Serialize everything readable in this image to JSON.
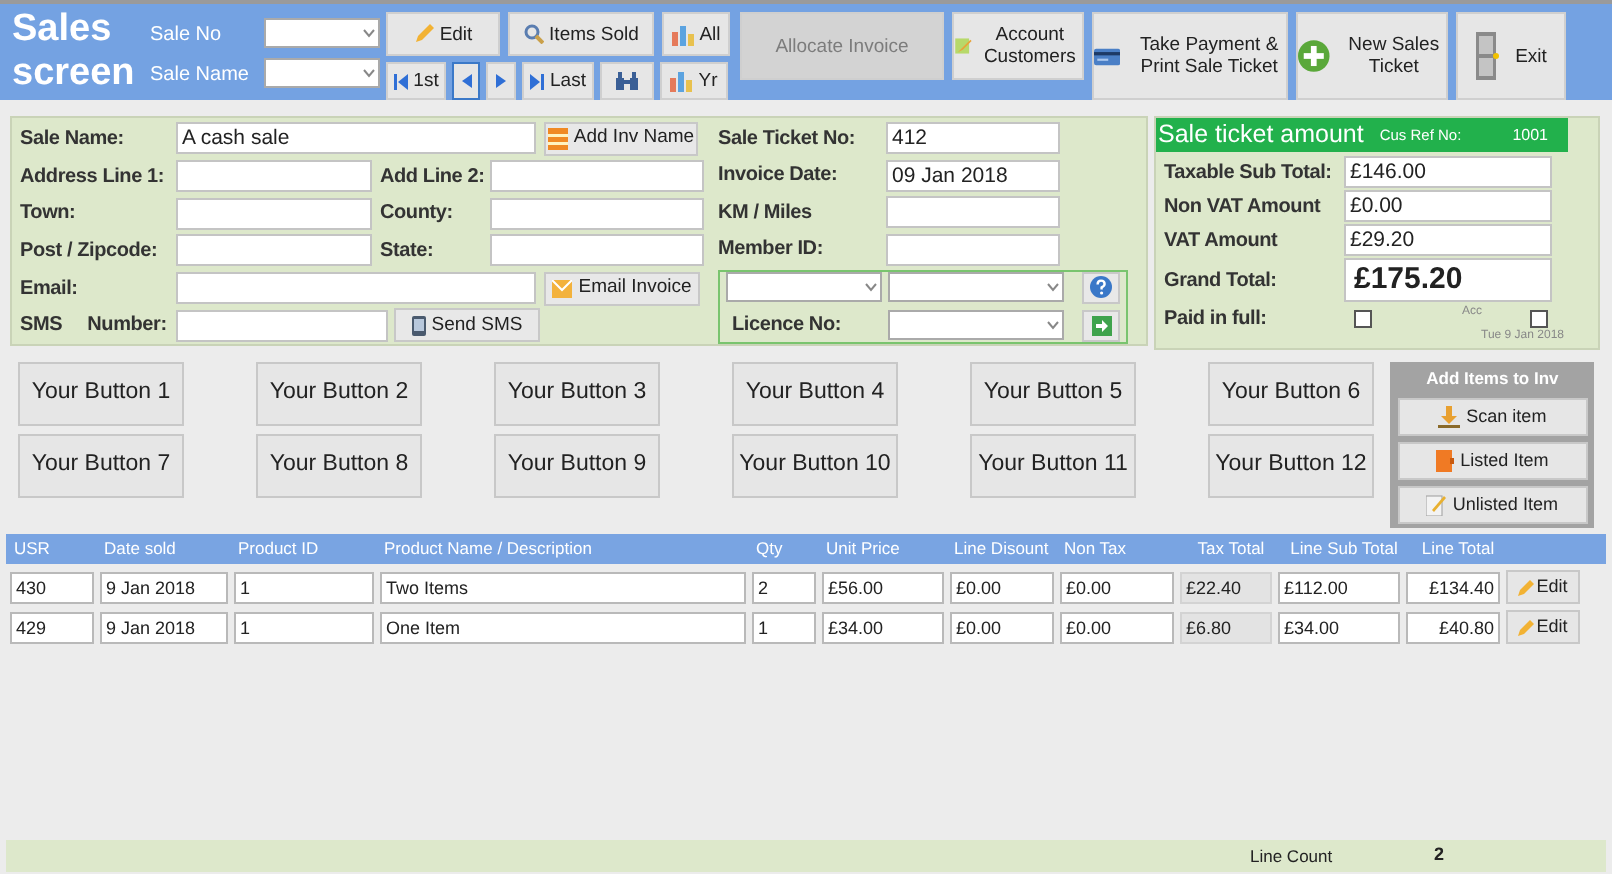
{
  "header": {
    "title": "Sales screen",
    "sale_no_label": "Sale No",
    "sale_name_label": "Sale Name",
    "buttons": [
      {
        "label": "Edit",
        "disabled": false
      },
      {
        "label": "Items Sold",
        "disabled": false
      },
      {
        "label": "All",
        "disabled": false
      },
      {
        "label": "Allocate Invoice",
        "disabled": true
      },
      {
        "label": "Account Customers",
        "disabled": false
      },
      {
        "label": "Take Payment & Print Sale Ticket",
        "disabled": false
      },
      {
        "label": "New Sales Ticket",
        "disabled": false
      },
      {
        "label": "Exit",
        "disabled": false
      },
      {
        "label": "1st",
        "disabled": false
      },
      {
        "label": "Last",
        "disabled": false
      },
      {
        "label": "Yr",
        "disabled": false
      }
    ]
  },
  "customer": {
    "sale_name_label": "Sale Name:",
    "sale_name": "A cash sale",
    "add_inv_name_button": "Add Inv Name",
    "address_fields": [
      {
        "label": "Address Line 1:"
      },
      {
        "label": "Add Line 2:"
      },
      {
        "label": "Town:"
      },
      {
        "label": "County:"
      },
      {
        "label": "Post / Zipcode:"
      },
      {
        "label": "State:"
      }
    ],
    "email_label": "Email:",
    "email_button": "Email Invoice",
    "sms_label": "SMS Number:",
    "send_sms_button": "Send SMS"
  },
  "ticket": {
    "fields": [
      {
        "label": "Sale Ticket No:",
        "value": "412"
      },
      {
        "label": "Invoice Date:",
        "value": "09 Jan 2018"
      },
      {
        "label": "KM / Miles"
      },
      {
        "label": "Member ID:"
      }
    ],
    "licence_label": "Licence No:"
  },
  "totals": {
    "title": "Sale ticket amount",
    "cus_ref_label": "Cus Ref No:",
    "cus_ref": "1001",
    "rows": [
      {
        "label": "Taxable Sub Total:",
        "value": "£146.00",
        "kind": "normal"
      },
      {
        "label": "Non VAT Amount",
        "value": "£0.00",
        "kind": "normal"
      },
      {
        "label": "VAT Amount",
        "value": "£29.20",
        "kind": "normal"
      },
      {
        "label": "Grand Total:",
        "value": "£175.20",
        "kind": "grand"
      }
    ],
    "paid_label": "Paid in full:",
    "paid_in_full": false,
    "acc_label": "Acc",
    "acc": false,
    "date": "Tue 9 Jan 2018"
  },
  "custom_buttons": [
    "Your Button 1",
    "Your Button 2",
    "Your Button 3",
    "Your Button 4",
    "Your Button 5",
    "Your Button 6",
    "Your Button 7",
    "Your Button 8",
    "Your Button 9",
    "Your Button 10",
    "Your Button 11",
    "Your Button 12"
  ],
  "add_items": {
    "title": "Add Items to Inv",
    "buttons": [
      "Scan item",
      "Listed Item",
      "Unlisted Item"
    ]
  },
  "table": {
    "columns": [
      "USR",
      "Date sold",
      "Product ID",
      "Product Name / Description",
      "Qty",
      "Unit Price",
      "Line Disount",
      "Non Tax",
      "Tax Total",
      "Line Sub Total",
      "Line Total"
    ],
    "rows": [
      {
        "cells": [
          "430",
          "9 Jan 2018",
          "1",
          "Two Items",
          "2",
          "£56.00",
          "£0.00",
          "£0.00",
          "£22.40",
          "£112.00",
          "£134.40"
        ],
        "edit": "Edit"
      },
      {
        "cells": [
          "429",
          "9 Jan 2018",
          "1",
          "One Item",
          "1",
          "£34.00",
          "£0.00",
          "£0.00",
          "£6.80",
          "£34.00",
          "£40.80"
        ],
        "edit": "Edit"
      }
    ]
  },
  "footer": {
    "label": "Line Count",
    "value": "2"
  }
}
